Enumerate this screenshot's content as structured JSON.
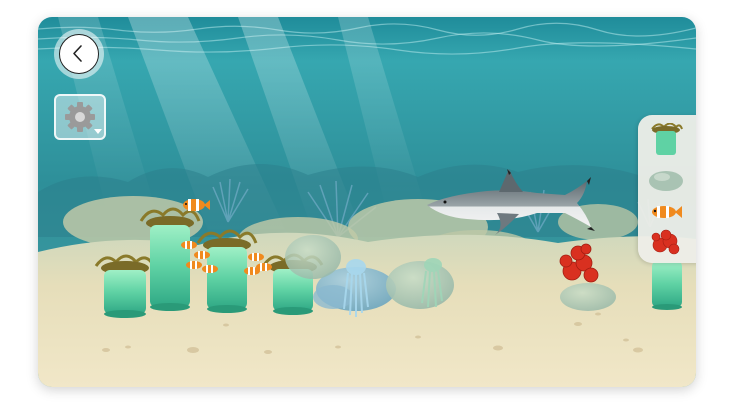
{
  "screen": {
    "name": "ocean-reef-builder",
    "colors": {
      "water_top": "#1f8c9a",
      "water_mid": "#38a8ad",
      "sand": "#e8dcba",
      "anemone_base": "#6fd6a6",
      "clownfish": "#f08a1e",
      "shark": "#7d8a90",
      "coral_red": "#d93020",
      "tray_bg": "#eeeee8"
    }
  },
  "toolbar": {
    "back_icon": "chevron-left-icon",
    "settings_icon": "gear-icon",
    "settings_caret_icon": "caret-down-icon"
  },
  "tray": {
    "items": [
      {
        "id": "anemone",
        "icon": "anemone-icon"
      },
      {
        "id": "rock",
        "icon": "rock-icon"
      },
      {
        "id": "clownfish",
        "icon": "clownfish-icon"
      },
      {
        "id": "red-coral",
        "icon": "red-coral-icon"
      }
    ]
  }
}
